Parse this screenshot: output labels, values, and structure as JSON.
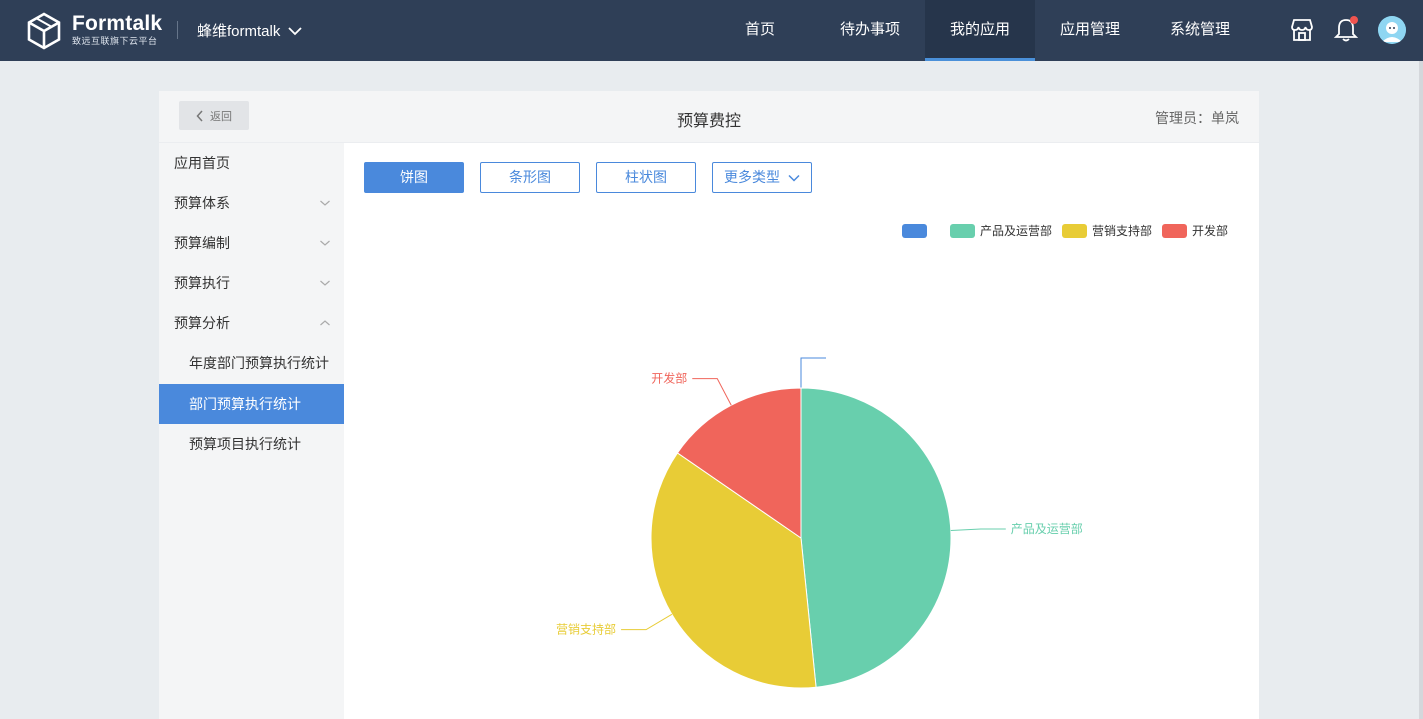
{
  "brand": {
    "name": "Formtalk",
    "tagline": "致远互联旗下云平台"
  },
  "org": {
    "name": "蜂维formtalk"
  },
  "nav": [
    {
      "label": "首页",
      "active": false
    },
    {
      "label": "待办事项",
      "active": false
    },
    {
      "label": "我的应用",
      "active": true
    },
    {
      "label": "应用管理",
      "active": false
    },
    {
      "label": "系统管理",
      "active": false
    }
  ],
  "header_icons": [
    "store-icon",
    "bell-icon",
    "avatar"
  ],
  "page": {
    "back_label": "返回",
    "title": "预算费控",
    "admin": "管理员：单岚"
  },
  "sidebar": {
    "items": [
      {
        "label": "应用首页",
        "type": "item"
      },
      {
        "label": "预算体系",
        "type": "group",
        "expanded": false
      },
      {
        "label": "预算编制",
        "type": "group",
        "expanded": false
      },
      {
        "label": "预算执行",
        "type": "group",
        "expanded": false
      },
      {
        "label": "预算分析",
        "type": "group",
        "expanded": true
      },
      {
        "label": "年度部门预算执行统计",
        "type": "sub"
      },
      {
        "label": "部门预算执行统计",
        "type": "sub",
        "active": true
      },
      {
        "label": "预算项目执行统计",
        "type": "sub"
      }
    ]
  },
  "chart_tabs": [
    {
      "label": "饼图",
      "active": true
    },
    {
      "label": "条形图",
      "active": false
    },
    {
      "label": "柱状图",
      "active": false
    },
    {
      "label": "更多类型",
      "active": false,
      "dropdown": true
    }
  ],
  "colors": {
    "accent": "#4a89dc",
    "topbar": "#2f3f57",
    "series": [
      "#4a89dc",
      "#68cfad",
      "#e8cc36",
      "#f0655b"
    ]
  },
  "chart_data": {
    "type": "pie",
    "legend_position": "top-right",
    "categories": [
      "",
      "产品及运营部",
      "营销支持部",
      "开发部"
    ],
    "values": [
      0,
      48.4,
      36.2,
      15.4
    ],
    "unit": "%"
  }
}
